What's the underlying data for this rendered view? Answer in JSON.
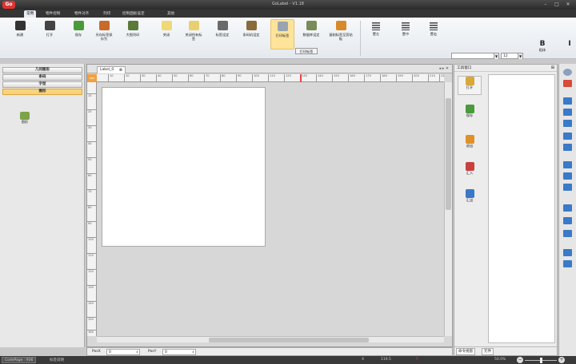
{
  "window": {
    "title": "GoLabel - V1.18",
    "logo": "Go"
  },
  "menu_tabs": [
    "常用",
    "物件控制",
    "物件对齐",
    "列印",
    "控制面板设定",
    "其他"
  ],
  "ribbon": {
    "buttons": [
      "新建",
      "打开",
      "保存",
      "另存标签保存为",
      "大图列印",
      "关闭",
      "关闭所有标签",
      "标签设定",
      "条码机设定",
      "打印标签",
      "数据库设定",
      "复制标签至剪贴板"
    ],
    "tooltip": "打印标签",
    "align": [
      "置左",
      "置中",
      "置右"
    ],
    "font_size": "12",
    "bold_glyph": "B",
    "bold_label": "粗体",
    "right_edge_glyph": "I"
  },
  "left_panel": {
    "categories": [
      "几何图形",
      "条码",
      "字型",
      "图形"
    ],
    "picture_item": "图形"
  },
  "document": {
    "tab_label": "Label_0",
    "ruler_corner": "mm",
    "h_ticks": [
      "10",
      "20",
      "30",
      "40",
      "50",
      "60",
      "70",
      "80",
      "90",
      "100",
      "110",
      "120",
      "130",
      "140",
      "150",
      "160",
      "170",
      "180",
      "190",
      "200",
      "210",
      "22"
    ],
    "v_ticks": [
      "10",
      "20",
      "30",
      "40",
      "50",
      "60",
      "70",
      "80",
      "90",
      "100",
      "110",
      "120",
      "130",
      "140",
      "150",
      "160"
    ]
  },
  "position_bar": {
    "posx_label": "PosX",
    "posx_value": "0",
    "posy_label": "PosY",
    "posy_value": "0"
  },
  "tool_window": {
    "title": "工具窗口",
    "tools": [
      "打开",
      "保存",
      "退出",
      "汇入",
      "汇出"
    ],
    "tabs": [
      "命令视窗",
      "元件"
    ]
  },
  "status": {
    "codepage": "CodePage : 936",
    "message": "标签说明",
    "x_label": "X",
    "x_value": "119.5",
    "y_value": "Y",
    "zoom": "50.0%",
    "zoom_level": 0.5
  }
}
